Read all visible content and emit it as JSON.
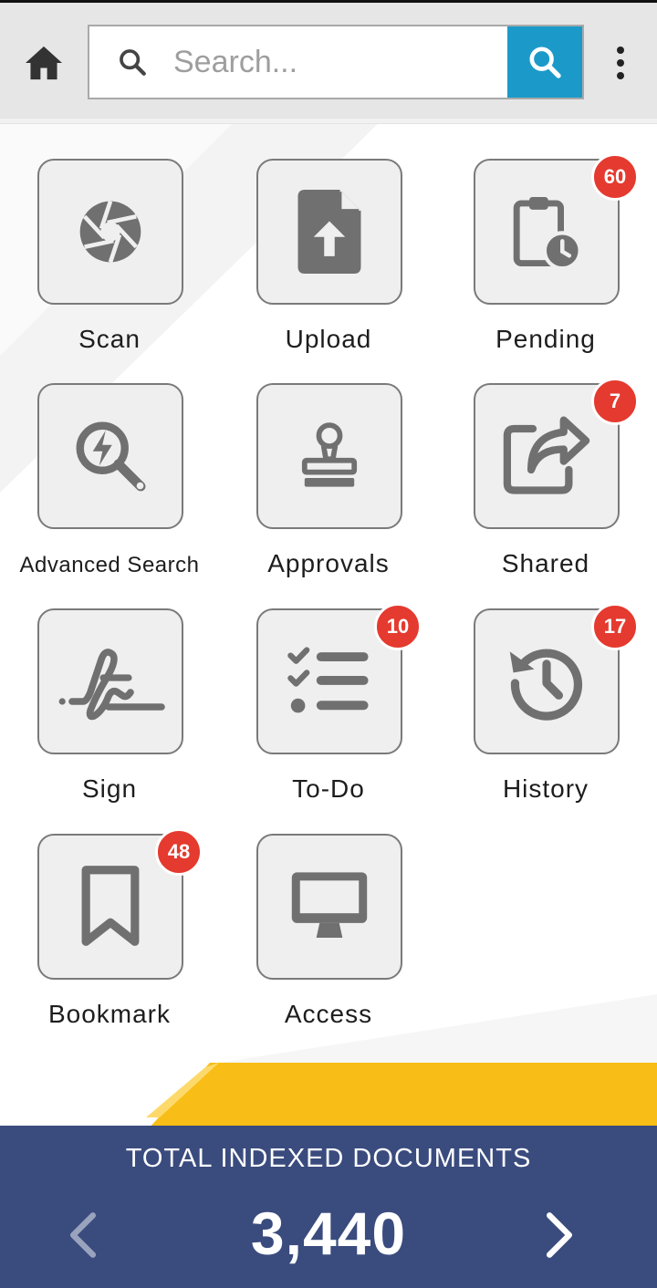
{
  "header": {
    "search_placeholder": "Search...",
    "icons": {
      "home": "home-icon",
      "search": "search-icon",
      "submit": "search-icon",
      "more": "more-vertical-icon"
    }
  },
  "tiles": [
    {
      "label": "Scan",
      "icon": "camera-shutter-icon",
      "badge": ""
    },
    {
      "label": "Upload",
      "icon": "file-upload-icon",
      "badge": ""
    },
    {
      "label": "Pending",
      "icon": "clipboard-clock-icon",
      "badge": "60"
    },
    {
      "label": "Advanced Search",
      "icon": "search-lightning-icon",
      "badge": ""
    },
    {
      "label": "Approvals",
      "icon": "stamp-icon",
      "badge": ""
    },
    {
      "label": "Shared",
      "icon": "share-icon",
      "badge": "7"
    },
    {
      "label": "Sign",
      "icon": "signature-icon",
      "badge": ""
    },
    {
      "label": "To-Do",
      "icon": "checklist-icon",
      "badge": "10"
    },
    {
      "label": "History",
      "icon": "history-icon",
      "badge": "17"
    },
    {
      "label": "Bookmark",
      "icon": "bookmark-icon",
      "badge": "48"
    },
    {
      "label": "Access",
      "icon": "monitor-icon",
      "badge": ""
    }
  ],
  "footer": {
    "title": "TOTAL INDEXED DOCUMENTS",
    "count": "3,440",
    "prev_icon": "chevron-left-icon",
    "next_icon": "chevron-right-icon"
  },
  "colors": {
    "accent_blue": "#1b9ac9",
    "badge_red": "#e53a2f",
    "footer_navy": "#3a4b7e",
    "stripe_yellow": "#f8bd16",
    "icon_gray": "#707070"
  }
}
